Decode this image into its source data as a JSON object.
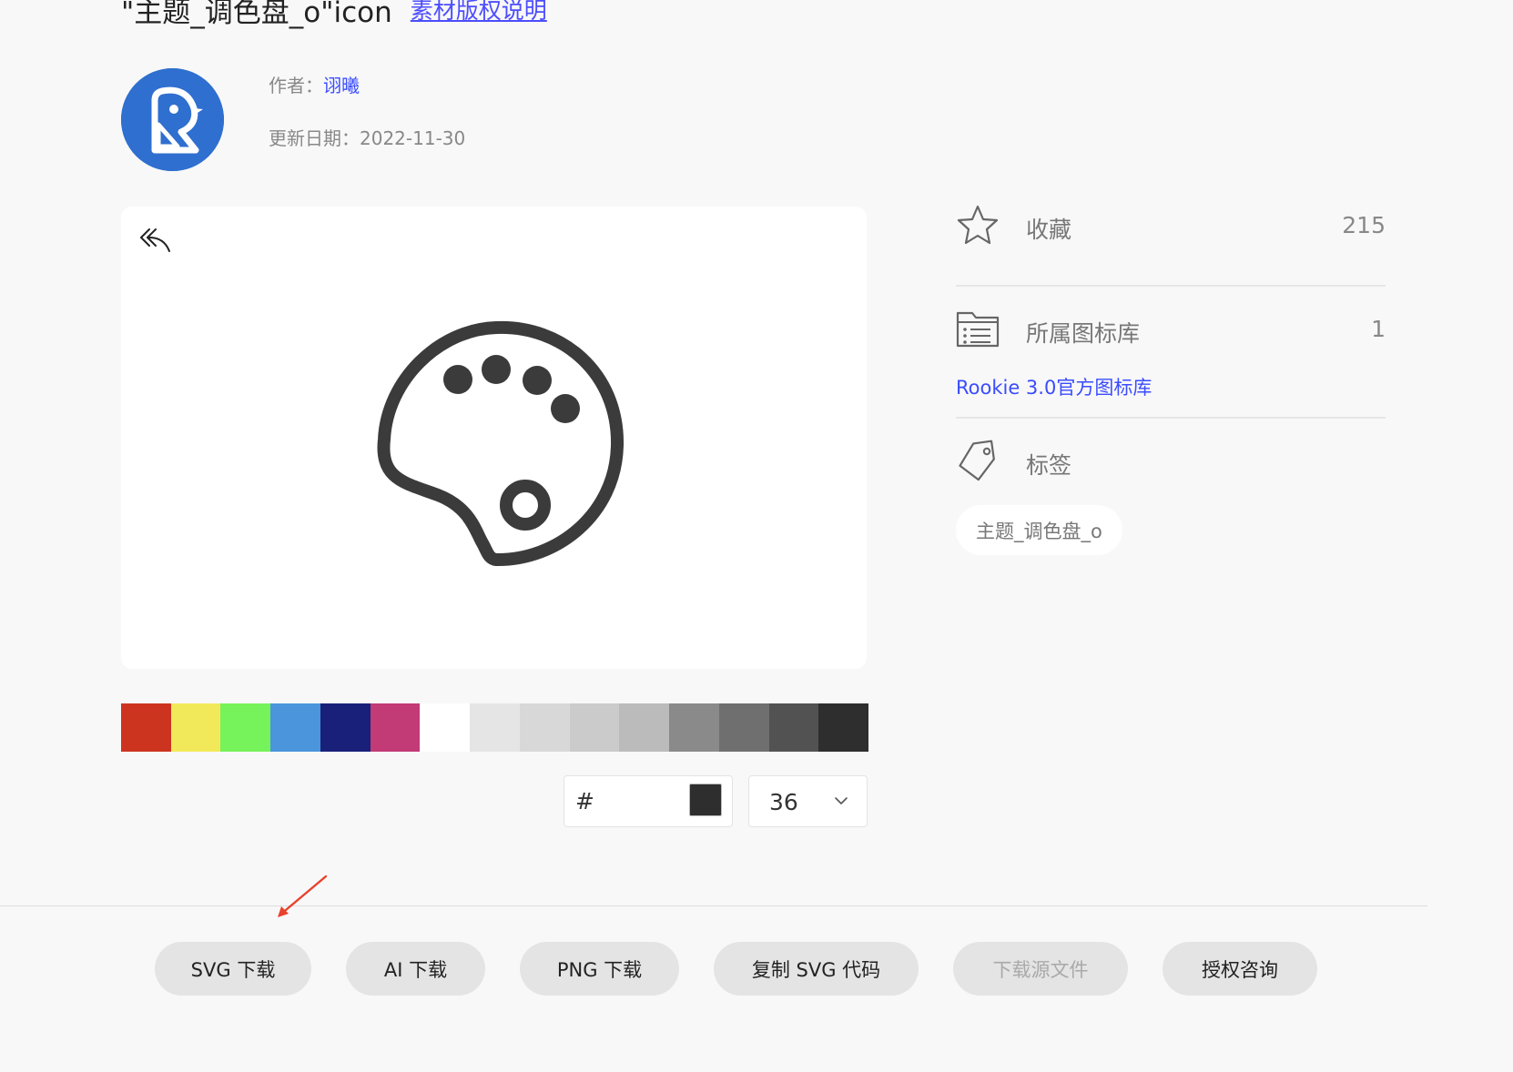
{
  "header": {
    "title": "\"主题_调色盘_o\"icon",
    "copyright_link": "素材版权说明"
  },
  "meta": {
    "author_label": "作者：",
    "author_name": "诩曦",
    "date_label": "更新日期：",
    "date_value": "2022-11-30"
  },
  "colors": {
    "brand_avatar": "#2f6fcf",
    "link": "#3a4cff",
    "icon_stroke": "#3b3b3b",
    "arrow": "#e8412c"
  },
  "swatches": [
    "#cc3420",
    "#f2e95a",
    "#76f25a",
    "#4a95dc",
    "#19207a",
    "#c23a76",
    "#ffffff",
    "#e5e5e5",
    "#d8d8d8",
    "#cbcbcb",
    "#bbbbbb",
    "#8a8a8a",
    "#6f6f6f",
    "#525252",
    "#2e2e2e"
  ],
  "controls": {
    "hex_prefix": "#",
    "current_color": "#2e2e2e",
    "size_value": "36"
  },
  "sidebar": {
    "favorites_label": "收藏",
    "favorites_count": "215",
    "library_label": "所属图标库",
    "library_count": "1",
    "library_name": "Rookie 3.0官方图标库",
    "tags_label": "标签",
    "tag": "主题_调色盘_o"
  },
  "actions": {
    "svg_download": "SVG 下载",
    "ai_download": "AI 下载",
    "png_download": "PNG 下载",
    "copy_svg": "复制 SVG 代码",
    "download_source": "下载源文件",
    "license": "授权咨询"
  }
}
